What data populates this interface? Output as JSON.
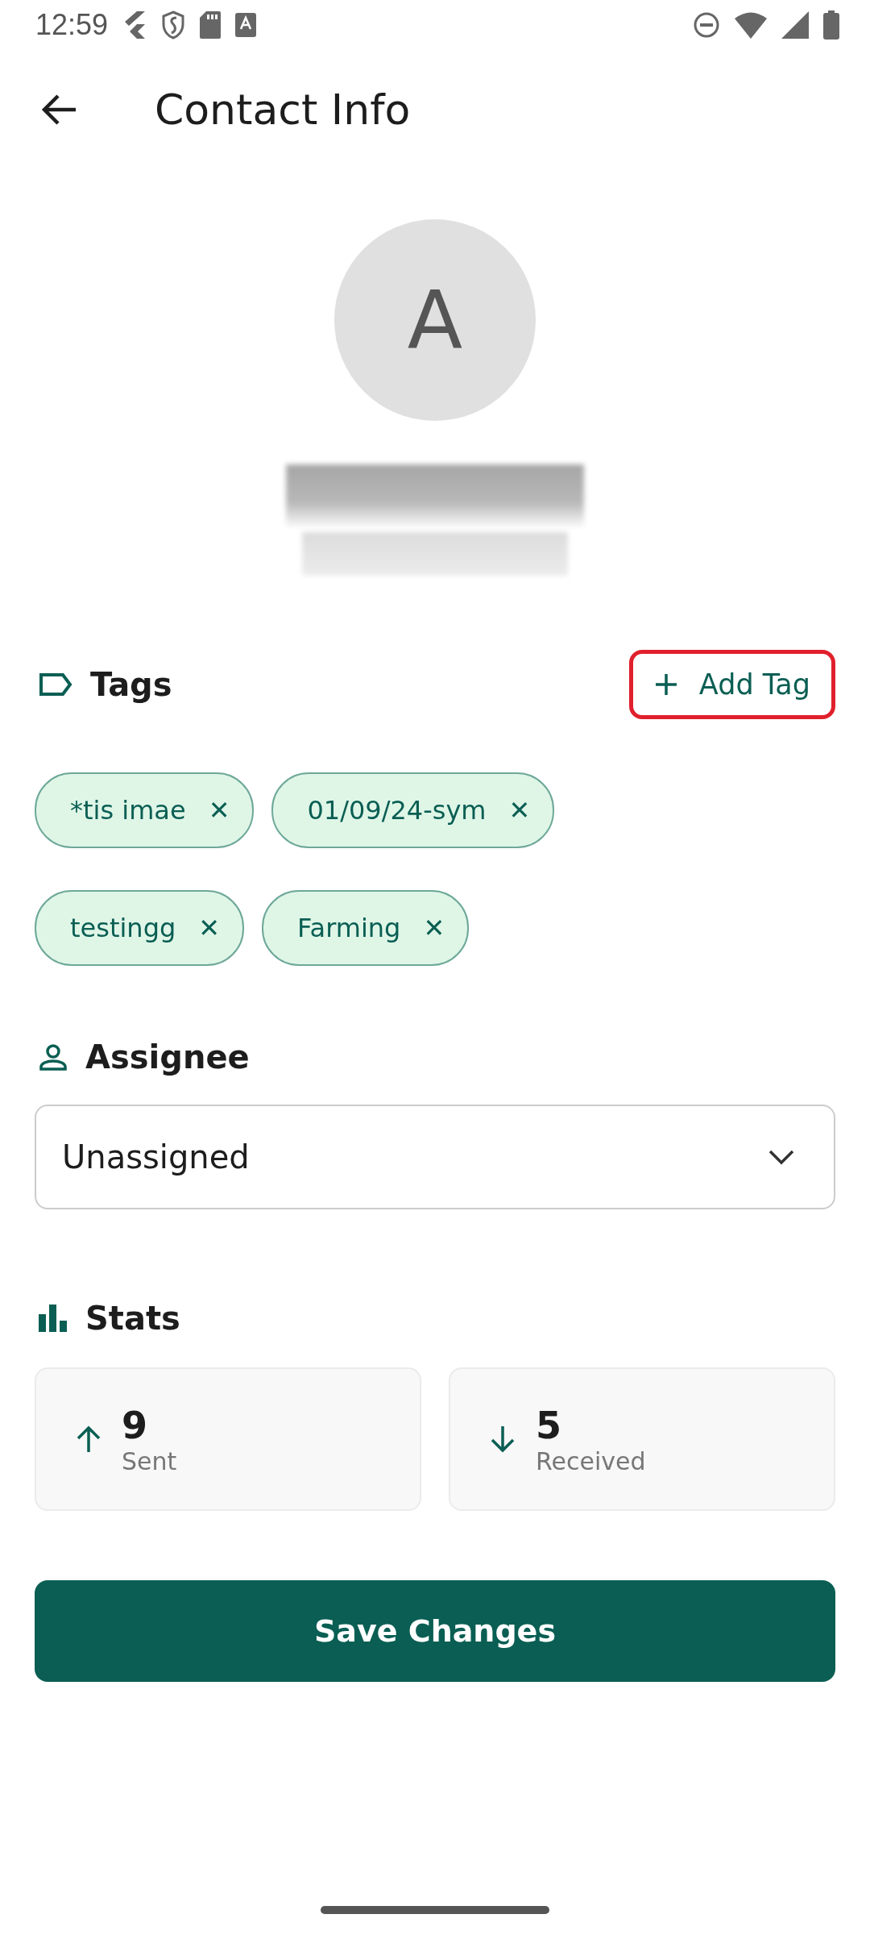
{
  "status_bar": {
    "time": "12:59"
  },
  "app_bar": {
    "title": "Contact Info"
  },
  "contact": {
    "avatar_initial": "A"
  },
  "tags": {
    "title": "Tags",
    "add_button": "Add Tag",
    "remove_symbol": "✕",
    "items": [
      {
        "label": "*tis imae"
      },
      {
        "label": "01/09/24-sym"
      },
      {
        "label": "testingg"
      },
      {
        "label": "Farming"
      }
    ]
  },
  "assignee": {
    "title": "Assignee",
    "value": "Unassigned"
  },
  "stats": {
    "title": "Stats",
    "items": [
      {
        "kind": "sent",
        "value": "9",
        "label": "Sent"
      },
      {
        "kind": "received",
        "value": "5",
        "label": "Received"
      }
    ]
  },
  "save_button": "Save Changes"
}
